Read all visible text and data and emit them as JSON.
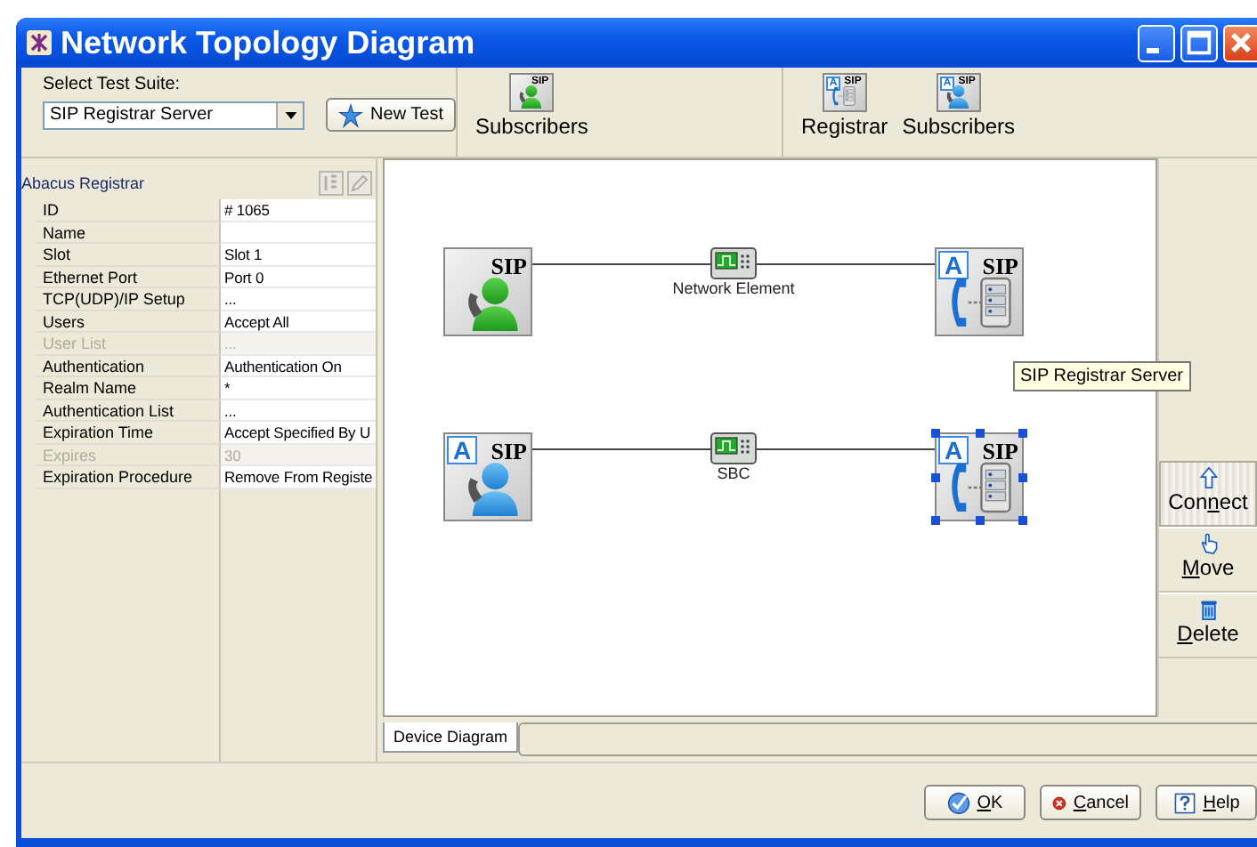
{
  "window": {
    "title": "Network Topology Diagram"
  },
  "toolbar": {
    "suite_label": "Select Test Suite:",
    "suite_value": "SIP Registrar Server",
    "new_test_button": "New Test",
    "groups": [
      {
        "items": [
          {
            "kind": "subscriber",
            "tag": "SIP",
            "label": "Subscribers"
          }
        ]
      },
      {
        "items": [
          {
            "kind": "registrar",
            "badge": "A",
            "tag": "SIP",
            "label": "Registrar"
          },
          {
            "kind": "subscriber-a",
            "badge": "A",
            "tag": "SIP",
            "label": "Subscribers"
          }
        ]
      }
    ]
  },
  "properties": {
    "title": "Abacus Registrar",
    "rows": [
      {
        "name": "ID",
        "value": "# 1065",
        "disabled": false
      },
      {
        "name": "Name",
        "disabled": false
      },
      {
        "name": "Slot",
        "value": "Slot 1",
        "disabled": false
      },
      {
        "name": "Ethernet Port",
        "value": "Port 0",
        "disabled": false
      },
      {
        "name": "TCP(UDP)/IP Setup",
        "value": "...",
        "disabled": false
      },
      {
        "name": "Users",
        "value": "Accept All",
        "disabled": false
      },
      {
        "name": "User List",
        "value": "...",
        "disabled": true
      },
      {
        "name": "Authentication",
        "value": "Authentication On",
        "disabled": false
      },
      {
        "name": "Realm Name",
        "value": "*",
        "disabled": false
      },
      {
        "name": "Authentication List",
        "value": "...",
        "disabled": false
      },
      {
        "name": "Expiration Time",
        "value": "Accept Specified By U",
        "disabled": false
      },
      {
        "name": "Expires",
        "value": "30",
        "disabled": true
      },
      {
        "name": "Expiration Procedure",
        "value": "Remove From Registe",
        "disabled": false
      }
    ]
  },
  "diagram": {
    "links": [
      {
        "from": {
          "kind": "subscriber",
          "tag": "SIP",
          "selected": false
        },
        "via": {
          "label": "Network Element"
        },
        "to": {
          "kind": "registrar",
          "badge": "A",
          "tag": "SIP",
          "selected": false
        }
      },
      {
        "from": {
          "kind": "subscriber-a",
          "badge": "A",
          "tag": "SIP",
          "selected": false
        },
        "via": {
          "label": "SBC"
        },
        "to": {
          "kind": "registrar",
          "badge": "A",
          "tag": "SIP",
          "selected": true
        }
      }
    ],
    "tooltip": "SIP Registrar Server"
  },
  "tools": [
    {
      "kind": "connect",
      "before": "Con",
      "key": "n",
      "after": "ect",
      "selected": true
    },
    {
      "kind": "move",
      "key": "M",
      "after": "ove",
      "selected": false
    },
    {
      "kind": "delete",
      "key": "D",
      "after": "elete",
      "selected": false
    }
  ],
  "tabs": [
    {
      "label": "Device Diagram",
      "selected": true
    }
  ],
  "buttons": [
    {
      "kind": "ok",
      "key": "O",
      "after": "K"
    },
    {
      "kind": "cancel",
      "key": "C",
      "after": "ancel"
    },
    {
      "kind": "help",
      "key": "H",
      "after": "elp"
    }
  ]
}
